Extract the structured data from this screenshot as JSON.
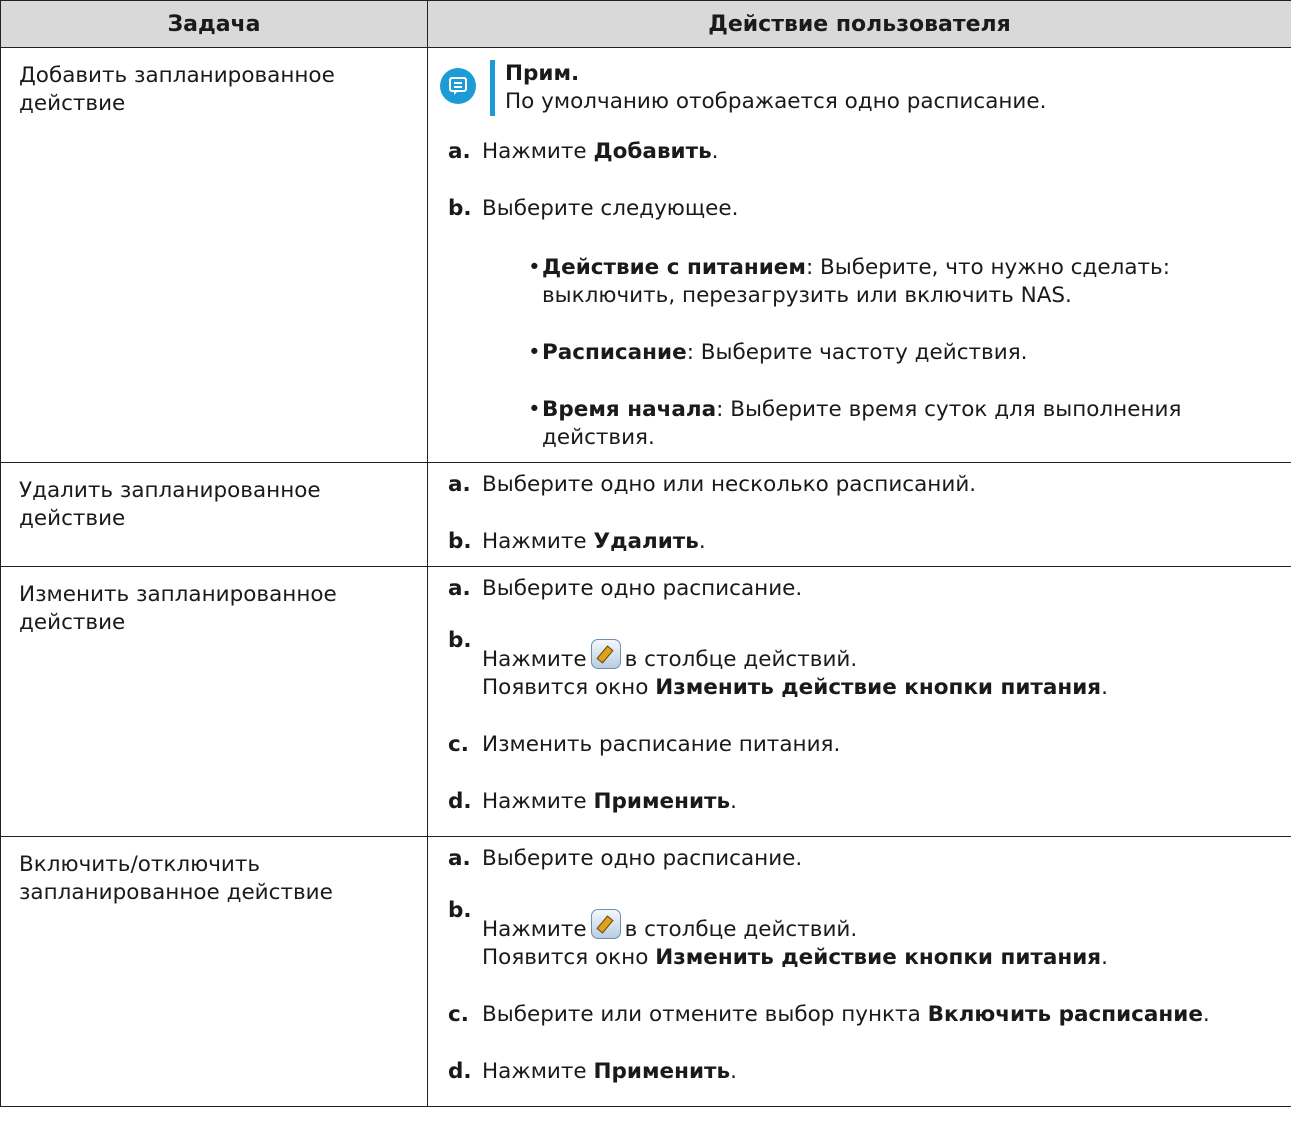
{
  "header": {
    "col1": "Задача",
    "col2": "Действие пользователя"
  },
  "rows": [
    {
      "task": "Добавить запланированное действие",
      "note_title": "Прим.",
      "note_text": "По умолчанию отображается одно расписание.",
      "a_text": "Нажмите ",
      "a_bold": "Добавить",
      "a_end": ".",
      "b_text": "Выберите следующее.",
      "bullets": [
        {
          "bold": "Действие с питанием",
          "text": ": Выберите, что нужно сделать: выключить, перезагрузить или включить NAS."
        },
        {
          "bold": "Расписание",
          "text": ": Выберите частоту действия."
        },
        {
          "bold": "Время начала",
          "text": ": Выберите время суток для выполнения действия."
        }
      ]
    },
    {
      "task": "Удалить запланированное действие",
      "a_text": "Выберите одно или несколько расписаний.",
      "b_text": "Нажмите ",
      "b_bold": "Удалить",
      "b_end": "."
    },
    {
      "task": "Изменить запланированное действие",
      "a_text": "Выберите одно расписание.",
      "b_pre": "Нажмите",
      "b_post": "в столбце действий.",
      "b_line2": "Появится окно ",
      "b_line2_bold": "Изменить действие кнопки питания",
      "b_line2_end": ".",
      "c_text": "Изменить расписание питания.",
      "d_text": "Нажмите ",
      "d_bold": "Применить",
      "d_end": "."
    },
    {
      "task": "Включить/отключить запланированное действие",
      "a_text": "Выберите одно расписание.",
      "b_pre": "Нажмите",
      "b_post": "в столбце действий.",
      "b_line2": "Появится окно ",
      "b_line2_bold": "Изменить действие кнопки питания",
      "b_line2_end": ".",
      "c_text": "Выберите или отмените выбор пункта ",
      "c_bold": "Включить расписание",
      "c_end": ".",
      "d_text": "Нажмите ",
      "d_bold": "Применить",
      "d_end": "."
    }
  ],
  "labels": {
    "a": "a.",
    "b": "b.",
    "c": "c.",
    "d": "d.",
    "bullet": "•"
  },
  "icons": {
    "note": "note-icon",
    "edit": "edit-icon"
  },
  "colors": {
    "accent": "#1e9bd7",
    "header_bg": "#d9d9d9"
  }
}
